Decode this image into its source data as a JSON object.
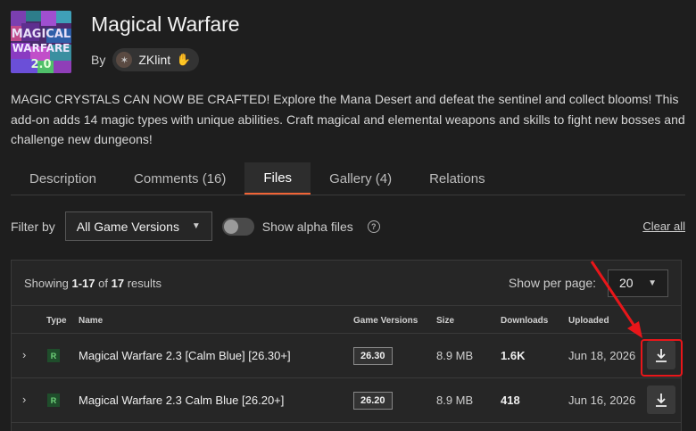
{
  "project": {
    "title": "Magical Warfare",
    "by_label": "By",
    "author": "ZKlint",
    "summary": "MAGIC CRYSTALS CAN NOW BE CRAFTED! Explore the Mana Desert and defeat the sentinel and collect blooms! This add-on adds 14 magic types with unique abilities. Craft magical and elemental weapons and skills to fight new bosses and challenge new dungeons!"
  },
  "tabs": [
    {
      "label": "Description"
    },
    {
      "label": "Comments (16)"
    },
    {
      "label": "Files",
      "active": true
    },
    {
      "label": "Gallery (4)"
    },
    {
      "label": "Relations"
    }
  ],
  "filters": {
    "filter_label": "Filter by",
    "game_version": "All Game Versions",
    "alpha_label": "Show alpha files",
    "clear_all": "Clear all"
  },
  "results": {
    "showing_prefix": "Showing",
    "range": "1-17",
    "of_label": "of",
    "total": "17",
    "suffix": "results",
    "per_page_label": "Show per page:",
    "per_page": "20"
  },
  "table": {
    "headers": {
      "type": "Type",
      "name": "Name",
      "game_versions": "Game Versions",
      "size": "Size",
      "downloads": "Downloads",
      "uploaded": "Uploaded"
    },
    "rows": [
      {
        "type": "R",
        "name": "Magical Warfare 2.3 [Calm Blue] [26.30+]",
        "version": "26.30",
        "size": "8.9 MB",
        "downloads": "1.6K",
        "uploaded": "Jun 18, 2026"
      },
      {
        "type": "R",
        "name": "Magical Warfare 2.3 Calm Blue [26.20+]",
        "version": "26.20",
        "size": "8.9 MB",
        "downloads": "418",
        "uploaded": "Jun 16, 2026"
      }
    ]
  },
  "colors": {
    "accent": "#f16436",
    "annotation": "#e8161a",
    "release_badge": "#6fd37a"
  }
}
